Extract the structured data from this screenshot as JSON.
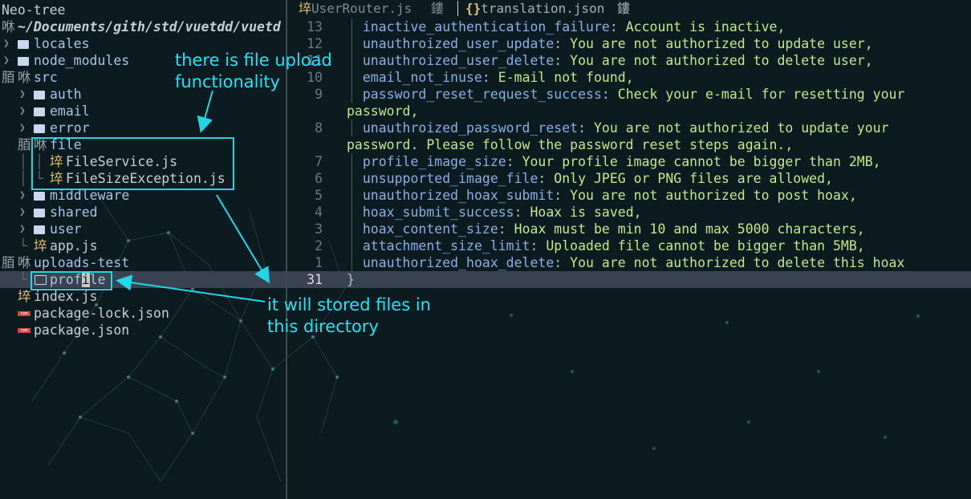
{
  "sidebar": {
    "title": "Neo-tree",
    "root_icon": "咻",
    "root_path": "~/Documents/gith/std/vuetdd/vuetd",
    "items": [
      {
        "label": "locales",
        "kind": "folder"
      },
      {
        "label": "node_modules",
        "kind": "folder"
      },
      {
        "label": "src",
        "kind": "folder-open"
      },
      {
        "label": "auth",
        "kind": "folder"
      },
      {
        "label": "email",
        "kind": "folder"
      },
      {
        "label": "error",
        "kind": "folder"
      },
      {
        "label": "file",
        "kind": "folder-open"
      },
      {
        "label": "FileService.js",
        "kind": "js"
      },
      {
        "label": "FileSizeException.js",
        "kind": "js"
      },
      {
        "label": "middleware",
        "kind": "folder"
      },
      {
        "label": "shared",
        "kind": "folder"
      },
      {
        "label": "user",
        "kind": "folder"
      },
      {
        "label": "app.js",
        "kind": "js"
      },
      {
        "label": "uploads-test",
        "kind": "folder-open"
      },
      {
        "label": "profile",
        "kind": "folder-empty"
      },
      {
        "label": "index.js",
        "kind": "js"
      },
      {
        "label": "package-lock.json",
        "kind": "npm"
      },
      {
        "label": "package.json",
        "kind": "npm"
      }
    ],
    "glyphs": {
      "open_a": "脜",
      "open_b": "咻",
      "js": "埣",
      "npm_text": "npm",
      "tree_branch": "│",
      "tree_end": "└"
    }
  },
  "editor": {
    "tabs": [
      {
        "label": "UserRouter.js",
        "icon": "埣",
        "close": "鏤",
        "active": false
      },
      {
        "label": "translation.json",
        "icon": "{}",
        "close": "鏤",
        "active": true
      }
    ],
    "lines": [
      {
        "num": "13",
        "key": "inactive_authentication_failure",
        "value": "Account is inactive,"
      },
      {
        "num": "12",
        "key": "unauthroized_user_update",
        "value": "You are not authorized to update user,"
      },
      {
        "num": "11",
        "key": "unauthroized_user_delete",
        "value": "You are not authorized to delete user,"
      },
      {
        "num": "10",
        "key": "email_not_inuse",
        "value": "E-mail not found,"
      },
      {
        "num": "9",
        "key": "password_reset_request_success",
        "value": "Check your e-mail for resetting your",
        "wrap": "password,"
      },
      {
        "num": "8",
        "key": "unauthroized_password_reset",
        "value": "You are not authorized to update your",
        "wrap": "password. Please follow the password reset steps again.,"
      },
      {
        "num": "7",
        "key": "profile_image_size",
        "value": "Your profile image cannot be bigger than 2MB,"
      },
      {
        "num": "6",
        "key": "unsupported_image_file",
        "value": "Only JPEG or PNG files are allowed,"
      },
      {
        "num": "5",
        "key": "unauthorized_hoax_submit",
        "value": "You are not authorized to post hoax,"
      },
      {
        "num": "4",
        "key": "hoax_submit_success",
        "value": "Hoax is saved,"
      },
      {
        "num": "3",
        "key": "hoax_content_size",
        "value": "Hoax must be min 10 and max 5000 characters,"
      },
      {
        "num": "2",
        "key": "attachment_size_limit",
        "value": "Uploaded file cannot be bigger than 5MB,"
      },
      {
        "num": "1",
        "key": "unauthorized_hoax_delete",
        "value": "You are not authorized to delete this hoax"
      }
    ],
    "current_line": {
      "num": "31",
      "text": "}"
    },
    "colon": ":"
  },
  "annotations": {
    "upload_note_line1": "there is file upload",
    "upload_note_line2": "functionality",
    "store_note_line1": "it will stored files in",
    "store_note_line2": "this directory",
    "color": "#22e3f5"
  }
}
